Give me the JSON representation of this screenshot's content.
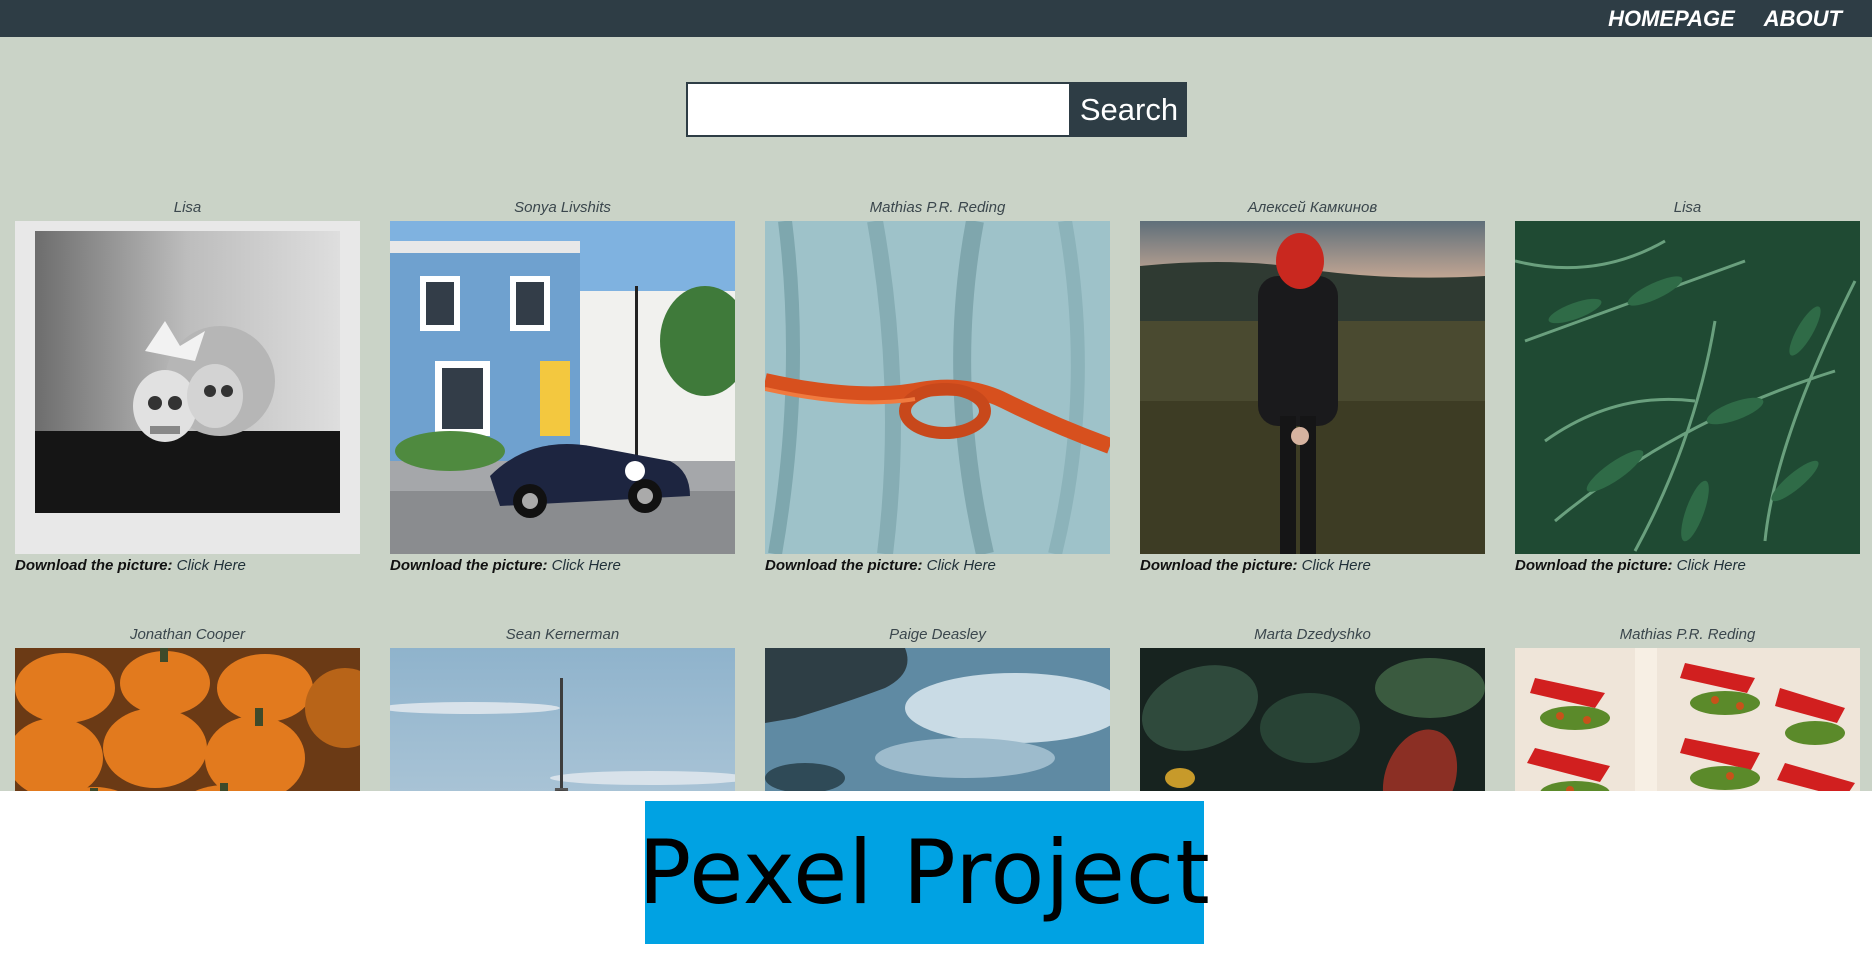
{
  "nav": {
    "home_label": "HOMEPAGE",
    "about_label": "ABOUT"
  },
  "search": {
    "value": "",
    "placeholder": "",
    "button_label": "Search"
  },
  "download_prefix": "Download the picture: ",
  "download_link": "Click Here",
  "photos": [
    {
      "author": "Lisa",
      "subject": "skull-polaroid"
    },
    {
      "author": "Sonya Livshits",
      "subject": "blue-house-car"
    },
    {
      "author": "Mathias P.R. Reding",
      "subject": "rope-fabric"
    },
    {
      "author": "Алексей Камкинов",
      "subject": "red-face-person"
    },
    {
      "author": "Lisa",
      "subject": "fern-leaves"
    },
    {
      "author": "Jonathan Cooper",
      "subject": "pumpkins"
    },
    {
      "author": "Sean Kernerman",
      "subject": "cn-tower"
    },
    {
      "author": "Paige Deasley",
      "subject": "lake-reflection"
    },
    {
      "author": "Marta Dzedyshko",
      "subject": "dark-leaves"
    },
    {
      "author": "Mathias P.R. Reding",
      "subject": "balcony-flowers"
    }
  ],
  "footer": {
    "title": "Pexel Project"
  },
  "colors": {
    "nav_bg": "#2e3d45",
    "page_bg": "#cad3c7",
    "footer_bg": "#00a2e3"
  }
}
